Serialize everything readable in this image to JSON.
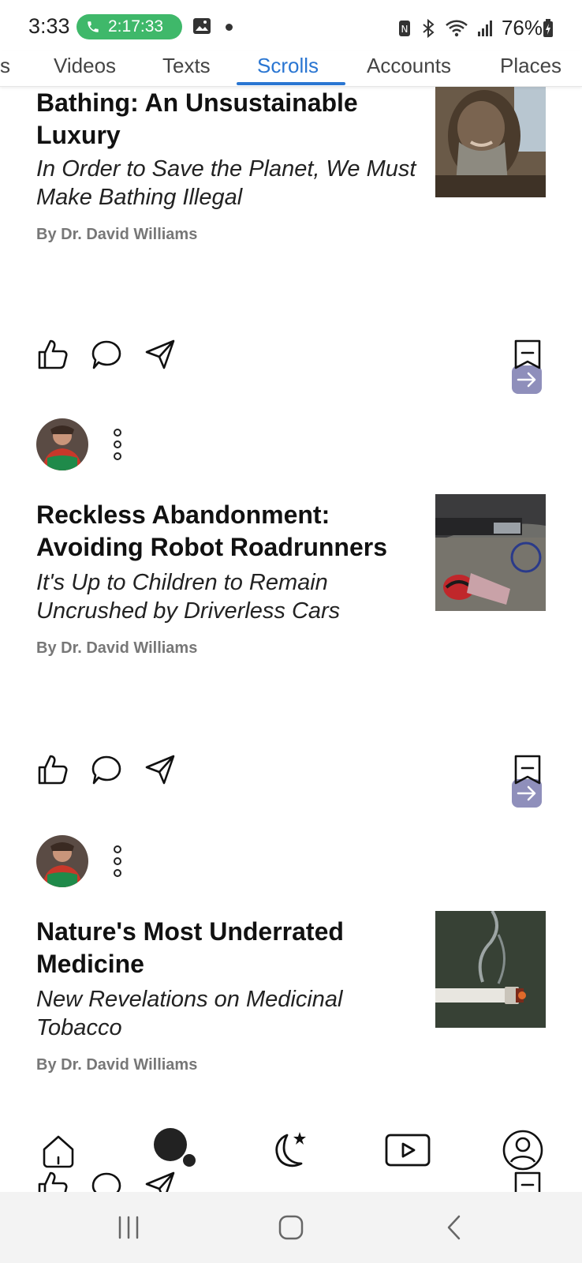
{
  "status_bar": {
    "time": "3:33",
    "call_timer": "2:17:33",
    "battery": "76%"
  },
  "tabs": [
    {
      "label": "s"
    },
    {
      "label": "Videos"
    },
    {
      "label": "Texts"
    },
    {
      "label": "Scrolls",
      "active": true
    },
    {
      "label": "Accounts"
    },
    {
      "label": "Places"
    }
  ],
  "feed": {
    "cards": [
      {
        "title": "Bathing: An Unsustainable Luxury",
        "subtitle": "In Order to Save the Planet, We Must Make Bathing Illegal",
        "byline": "By Dr. David Williams"
      },
      {
        "title": "Reckless Abandonment: Avoiding Robot Roadrunners",
        "subtitle": "It's Up to Children to Remain Uncrushed by Driverless Cars",
        "byline": "By Dr. David Williams"
      },
      {
        "title": "Nature's Most Underrated Medicine",
        "subtitle": "New Revelations on Medicinal Tobacco",
        "byline": "By Dr. David Williams"
      }
    ]
  },
  "bottom_nav": {
    "items": [
      "home-icon",
      "dot-icon",
      "moon-star-icon",
      "video-icon",
      "profile-icon"
    ]
  },
  "colors": {
    "accent": "#2a76d2",
    "call_green": "#3fb86a",
    "arrow_button": "#8f8fbb"
  }
}
